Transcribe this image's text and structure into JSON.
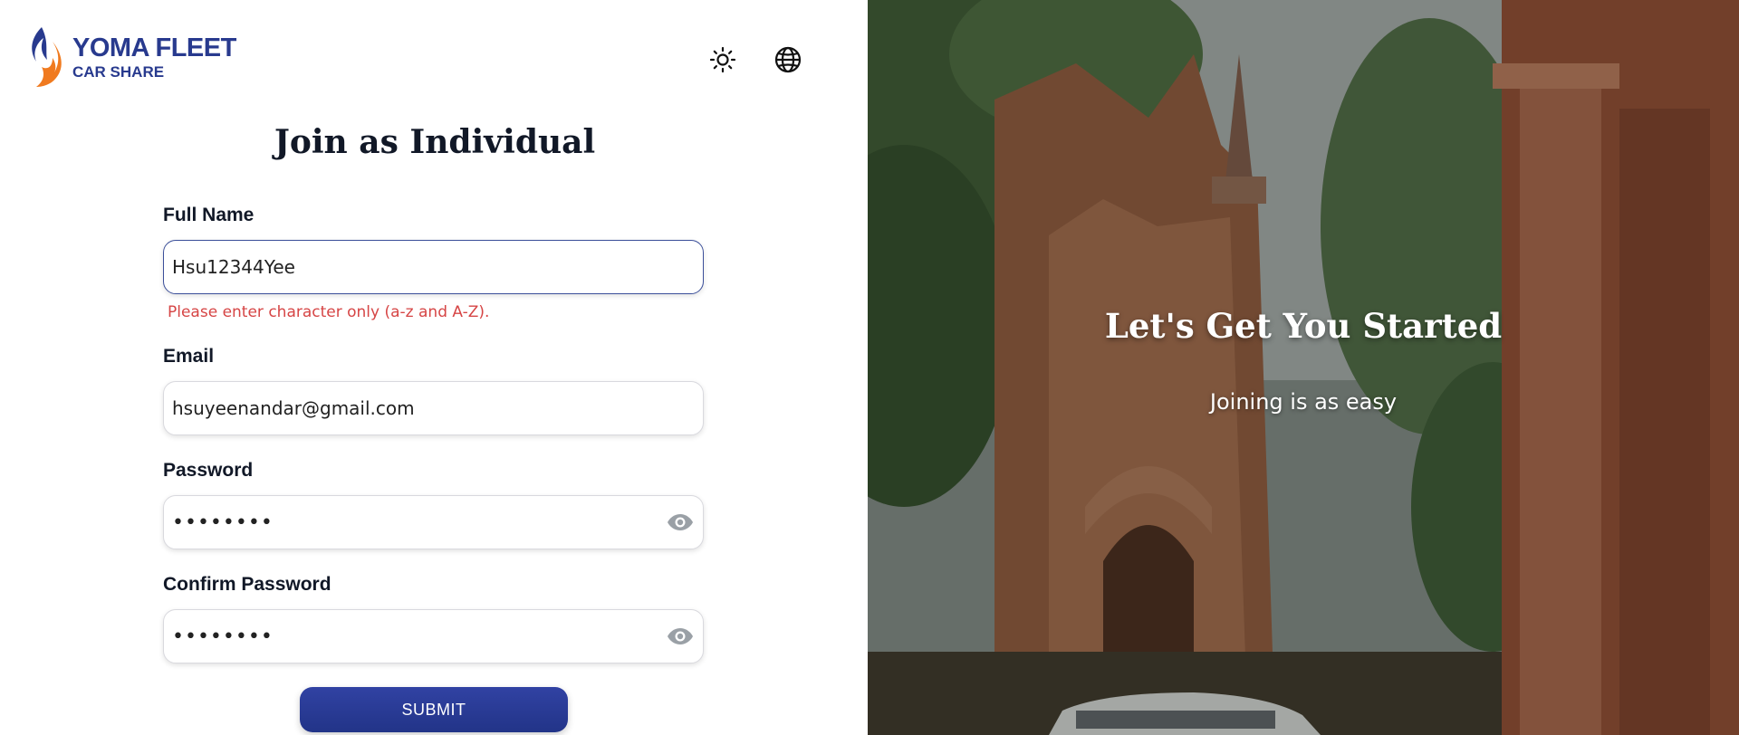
{
  "brand": {
    "title": "YOMA FLEET",
    "subtitle": "CAR SHARE",
    "colors": {
      "primary": "#283a8e",
      "flame_orange": "#f07a1f"
    }
  },
  "header": {
    "icons": [
      "sun-icon",
      "globe-icon"
    ]
  },
  "form": {
    "title": "Join as Individual",
    "full_name": {
      "label": "Full Name",
      "value": "Hsu12344Yee",
      "error": "Please enter character only (a-z and A-Z)."
    },
    "email": {
      "label": "Email",
      "value": "hsuyeenandar@gmail.com"
    },
    "password": {
      "label": "Password",
      "value": "••••••••"
    },
    "confirm_password": {
      "label": "Confirm Password",
      "value": "••••••••"
    },
    "submit_label": "SUBMIT",
    "colors": {
      "error": "#d64545",
      "button": "#283a8e"
    }
  },
  "hero": {
    "title": "Let's Get You Started",
    "subtitle": "Joining is as easy"
  }
}
